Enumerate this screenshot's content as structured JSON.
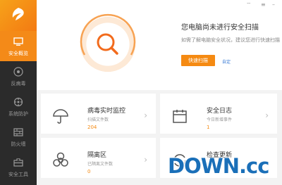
{
  "sidebar": {
    "items": [
      {
        "label": "安全概览",
        "icon": "monitor-icon",
        "active": true
      },
      {
        "label": "反病毒",
        "icon": "antivirus-icon",
        "active": false
      },
      {
        "label": "系统防护",
        "icon": "system-protection-icon",
        "active": false
      },
      {
        "label": "防火墙",
        "icon": "firewall-icon",
        "active": false
      },
      {
        "label": "安全工具",
        "icon": "toolbox-icon",
        "active": false
      }
    ]
  },
  "header": {
    "status_title": "您电脑尚未进行安全扫描",
    "status_sub": "如需了解电脑安全状况，建议您进行快速扫描",
    "scan_button": "快速扫描",
    "scan_link": "自定"
  },
  "cards": [
    {
      "title": "病毒实时监控",
      "label": "扫描文件数",
      "value": "204",
      "icon": "umbrella-icon"
    },
    {
      "title": "安全日志",
      "label": "今日新增事件",
      "value": "1",
      "icon": "calendar-icon"
    },
    {
      "title": "隔离区",
      "label": "已隔离文件数",
      "value": "0",
      "icon": "biohazard-icon"
    },
    {
      "title": "检查更新",
      "label": "",
      "value": "",
      "icon": "update-icon"
    }
  ],
  "watermark": {
    "text": "DOWN",
    "suffix": ".cc"
  },
  "colors": {
    "accent": "#f58a12",
    "sidebar_bg": "#2b2b2b",
    "link": "#3a7bd5"
  }
}
